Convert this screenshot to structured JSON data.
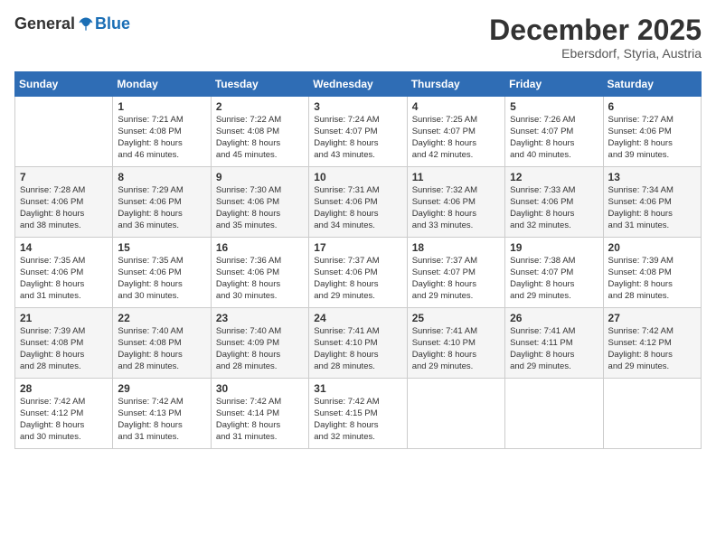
{
  "header": {
    "logo_general": "General",
    "logo_blue": "Blue",
    "month": "December 2025",
    "location": "Ebersdorf, Styria, Austria"
  },
  "weekdays": [
    "Sunday",
    "Monday",
    "Tuesday",
    "Wednesday",
    "Thursday",
    "Friday",
    "Saturday"
  ],
  "weeks": [
    [
      {
        "day": "",
        "info": ""
      },
      {
        "day": "1",
        "info": "Sunrise: 7:21 AM\nSunset: 4:08 PM\nDaylight: 8 hours\nand 46 minutes."
      },
      {
        "day": "2",
        "info": "Sunrise: 7:22 AM\nSunset: 4:08 PM\nDaylight: 8 hours\nand 45 minutes."
      },
      {
        "day": "3",
        "info": "Sunrise: 7:24 AM\nSunset: 4:07 PM\nDaylight: 8 hours\nand 43 minutes."
      },
      {
        "day": "4",
        "info": "Sunrise: 7:25 AM\nSunset: 4:07 PM\nDaylight: 8 hours\nand 42 minutes."
      },
      {
        "day": "5",
        "info": "Sunrise: 7:26 AM\nSunset: 4:07 PM\nDaylight: 8 hours\nand 40 minutes."
      },
      {
        "day": "6",
        "info": "Sunrise: 7:27 AM\nSunset: 4:06 PM\nDaylight: 8 hours\nand 39 minutes."
      }
    ],
    [
      {
        "day": "7",
        "info": "Sunrise: 7:28 AM\nSunset: 4:06 PM\nDaylight: 8 hours\nand 38 minutes."
      },
      {
        "day": "8",
        "info": "Sunrise: 7:29 AM\nSunset: 4:06 PM\nDaylight: 8 hours\nand 36 minutes."
      },
      {
        "day": "9",
        "info": "Sunrise: 7:30 AM\nSunset: 4:06 PM\nDaylight: 8 hours\nand 35 minutes."
      },
      {
        "day": "10",
        "info": "Sunrise: 7:31 AM\nSunset: 4:06 PM\nDaylight: 8 hours\nand 34 minutes."
      },
      {
        "day": "11",
        "info": "Sunrise: 7:32 AM\nSunset: 4:06 PM\nDaylight: 8 hours\nand 33 minutes."
      },
      {
        "day": "12",
        "info": "Sunrise: 7:33 AM\nSunset: 4:06 PM\nDaylight: 8 hours\nand 32 minutes."
      },
      {
        "day": "13",
        "info": "Sunrise: 7:34 AM\nSunset: 4:06 PM\nDaylight: 8 hours\nand 31 minutes."
      }
    ],
    [
      {
        "day": "14",
        "info": "Sunrise: 7:35 AM\nSunset: 4:06 PM\nDaylight: 8 hours\nand 31 minutes."
      },
      {
        "day": "15",
        "info": "Sunrise: 7:35 AM\nSunset: 4:06 PM\nDaylight: 8 hours\nand 30 minutes."
      },
      {
        "day": "16",
        "info": "Sunrise: 7:36 AM\nSunset: 4:06 PM\nDaylight: 8 hours\nand 30 minutes."
      },
      {
        "day": "17",
        "info": "Sunrise: 7:37 AM\nSunset: 4:06 PM\nDaylight: 8 hours\nand 29 minutes."
      },
      {
        "day": "18",
        "info": "Sunrise: 7:37 AM\nSunset: 4:07 PM\nDaylight: 8 hours\nand 29 minutes."
      },
      {
        "day": "19",
        "info": "Sunrise: 7:38 AM\nSunset: 4:07 PM\nDaylight: 8 hours\nand 29 minutes."
      },
      {
        "day": "20",
        "info": "Sunrise: 7:39 AM\nSunset: 4:08 PM\nDaylight: 8 hours\nand 28 minutes."
      }
    ],
    [
      {
        "day": "21",
        "info": "Sunrise: 7:39 AM\nSunset: 4:08 PM\nDaylight: 8 hours\nand 28 minutes."
      },
      {
        "day": "22",
        "info": "Sunrise: 7:40 AM\nSunset: 4:08 PM\nDaylight: 8 hours\nand 28 minutes."
      },
      {
        "day": "23",
        "info": "Sunrise: 7:40 AM\nSunset: 4:09 PM\nDaylight: 8 hours\nand 28 minutes."
      },
      {
        "day": "24",
        "info": "Sunrise: 7:41 AM\nSunset: 4:10 PM\nDaylight: 8 hours\nand 28 minutes."
      },
      {
        "day": "25",
        "info": "Sunrise: 7:41 AM\nSunset: 4:10 PM\nDaylight: 8 hours\nand 29 minutes."
      },
      {
        "day": "26",
        "info": "Sunrise: 7:41 AM\nSunset: 4:11 PM\nDaylight: 8 hours\nand 29 minutes."
      },
      {
        "day": "27",
        "info": "Sunrise: 7:42 AM\nSunset: 4:12 PM\nDaylight: 8 hours\nand 29 minutes."
      }
    ],
    [
      {
        "day": "28",
        "info": "Sunrise: 7:42 AM\nSunset: 4:12 PM\nDaylight: 8 hours\nand 30 minutes."
      },
      {
        "day": "29",
        "info": "Sunrise: 7:42 AM\nSunset: 4:13 PM\nDaylight: 8 hours\nand 31 minutes."
      },
      {
        "day": "30",
        "info": "Sunrise: 7:42 AM\nSunset: 4:14 PM\nDaylight: 8 hours\nand 31 minutes."
      },
      {
        "day": "31",
        "info": "Sunrise: 7:42 AM\nSunset: 4:15 PM\nDaylight: 8 hours\nand 32 minutes."
      },
      {
        "day": "",
        "info": ""
      },
      {
        "day": "",
        "info": ""
      },
      {
        "day": "",
        "info": ""
      }
    ]
  ]
}
